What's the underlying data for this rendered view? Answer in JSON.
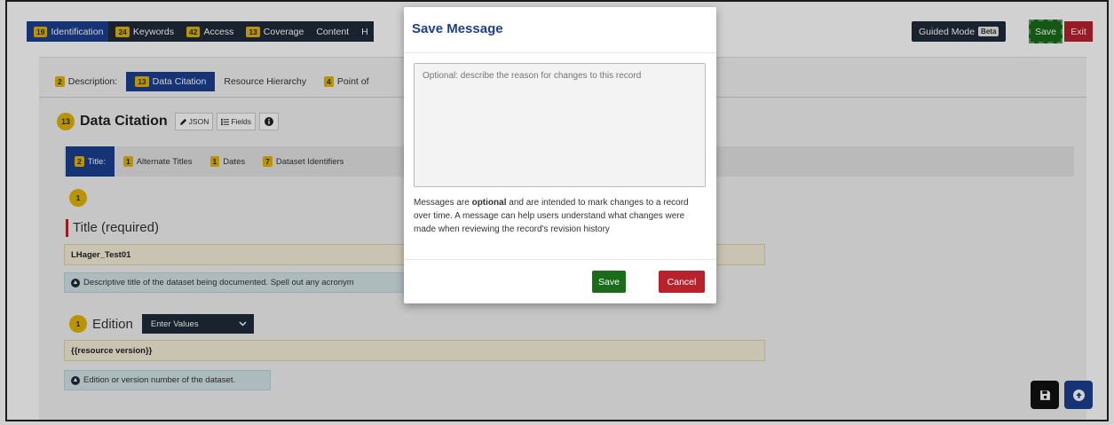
{
  "topnav": {
    "tabs": [
      {
        "badge": "19",
        "label": "Identification"
      },
      {
        "badge": "24",
        "label": "Keywords"
      },
      {
        "badge": "42",
        "label": "Access"
      },
      {
        "badge": "13",
        "label": "Coverage"
      },
      {
        "badge": "",
        "label": "Content"
      },
      {
        "badge": "",
        "label": "H"
      }
    ],
    "guided_mode": "Guided Mode",
    "beta": "Beta",
    "save": "Save",
    "exit": "Exit"
  },
  "subnav": {
    "tabs": [
      {
        "badge": "2",
        "label": "Description:"
      },
      {
        "badge": "13",
        "label": "Data Citation"
      },
      {
        "badge": "",
        "label": "Resource Hierarchy"
      },
      {
        "badge": "4",
        "label": "Point of"
      }
    ]
  },
  "section": {
    "badge": "13",
    "title": "Data Citation",
    "json_label": "JSON",
    "fields_label": "Fields"
  },
  "citation_tabs": [
    {
      "badge": "2",
      "label": "Title:"
    },
    {
      "badge": "1",
      "label": "Alternate Titles"
    },
    {
      "badge": "1",
      "label": "Dates"
    },
    {
      "badge": "7",
      "label": "Dataset Identifiers"
    }
  ],
  "title_field": {
    "badge": "1",
    "label": "Title (required)",
    "value": "LHager_Test01",
    "help": "Descriptive title of the dataset being documented. Spell out any acronym"
  },
  "edition_field": {
    "badge": "1",
    "label": "Edition",
    "select": "Enter Values",
    "value": "{{resource version}}",
    "help": "Edition or version number of the dataset."
  },
  "modal": {
    "title": "Save Message",
    "placeholder": "Optional: describe the reason for changes to this record",
    "msg_pre": "Messages are ",
    "msg_bold": "optional",
    "msg_post": " and are intended to mark changes to a record over time. A message can help users understand what changes were made when reviewing the record's revision history",
    "save": "Save",
    "cancel": "Cancel"
  },
  "colors": {
    "navy": "#1f2a3a",
    "blue": "#1c3f8f",
    "badge_yellow": "#e3b400",
    "save_green": "#1a6b1a",
    "exit_red": "#b8222c"
  }
}
